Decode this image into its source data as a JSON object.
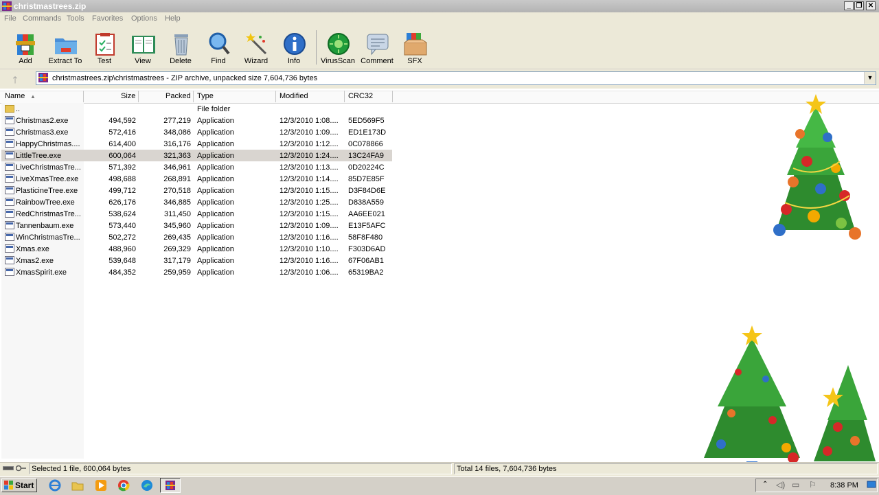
{
  "window": {
    "title": "christmastrees.zip",
    "min": "_",
    "max": "❐",
    "close": "✕"
  },
  "menu": [
    "File",
    "Commands",
    "Tools",
    "Favorites",
    "Options",
    "Help"
  ],
  "toolbar": [
    {
      "label": "Add",
      "icon": "add-archive-icon"
    },
    {
      "label": "Extract To",
      "icon": "extract-folder-icon"
    },
    {
      "label": "Test",
      "icon": "test-checklist-icon"
    },
    {
      "label": "View",
      "icon": "view-book-icon"
    },
    {
      "label": "Delete",
      "icon": "trash-can-icon"
    },
    {
      "label": "Find",
      "icon": "magnifier-icon"
    },
    {
      "label": "Wizard",
      "icon": "magic-wand-icon"
    },
    {
      "label": "Info",
      "icon": "info-icon"
    },
    {
      "label": "VirusScan",
      "icon": "virus-scan-icon"
    },
    {
      "label": "Comment",
      "icon": "comment-icon"
    },
    {
      "label": "SFX",
      "icon": "sfx-box-icon"
    }
  ],
  "address": {
    "up": "🡑",
    "path": "christmastrees.zip\\christmastrees - ZIP archive, unpacked size 7,604,736 bytes",
    "dropdown": "▼"
  },
  "columns": {
    "name": "Name",
    "sort": "▲",
    "size": "Size",
    "packed": "Packed",
    "type": "Type",
    "modified": "Modified",
    "crc": "CRC32"
  },
  "rows": [
    {
      "name": "..",
      "size": "",
      "packed": "",
      "type": "File folder",
      "modified": "",
      "crc": "",
      "folder": true
    },
    {
      "name": "Christmas2.exe",
      "size": "494,592",
      "packed": "277,219",
      "type": "Application",
      "modified": "12/3/2010 1:08....",
      "crc": "5ED569F5"
    },
    {
      "name": "Christmas3.exe",
      "size": "572,416",
      "packed": "348,086",
      "type": "Application",
      "modified": "12/3/2010 1:09....",
      "crc": "ED1E173D"
    },
    {
      "name": "HappyChristmas....",
      "size": "614,400",
      "packed": "316,176",
      "type": "Application",
      "modified": "12/3/2010 1:12....",
      "crc": "0C078866"
    },
    {
      "name": "LittleTree.exe",
      "size": "600,064",
      "packed": "321,363",
      "type": "Application",
      "modified": "12/3/2010 1:24....",
      "crc": "13C24FA9",
      "selected": true
    },
    {
      "name": "LiveChristmasTre...",
      "size": "571,392",
      "packed": "346,961",
      "type": "Application",
      "modified": "12/3/2010 1:13....",
      "crc": "0D20224C"
    },
    {
      "name": "LiveXmasTree.exe",
      "size": "498,688",
      "packed": "268,891",
      "type": "Application",
      "modified": "12/3/2010 1:14....",
      "crc": "85D7E85F"
    },
    {
      "name": "PlasticineTree.exe",
      "size": "499,712",
      "packed": "270,518",
      "type": "Application",
      "modified": "12/3/2010 1:15....",
      "crc": "D3F84D6E"
    },
    {
      "name": "RainbowTree.exe",
      "size": "626,176",
      "packed": "346,885",
      "type": "Application",
      "modified": "12/3/2010 1:25....",
      "crc": "D838A559"
    },
    {
      "name": "RedChristmasTre...",
      "size": "538,624",
      "packed": "311,450",
      "type": "Application",
      "modified": "12/3/2010 1:15....",
      "crc": "AA6EE021"
    },
    {
      "name": "Tannenbaum.exe",
      "size": "573,440",
      "packed": "345,960",
      "type": "Application",
      "modified": "12/3/2010 1:09....",
      "crc": "E13F5AFC"
    },
    {
      "name": "WinChristmasTre...",
      "size": "502,272",
      "packed": "269,435",
      "type": "Application",
      "modified": "12/3/2010 1:16....",
      "crc": "58F8F480"
    },
    {
      "name": "Xmas.exe",
      "size": "488,960",
      "packed": "269,329",
      "type": "Application",
      "modified": "12/3/2010 1:10....",
      "crc": "F303D6AD"
    },
    {
      "name": "Xmas2.exe",
      "size": "539,648",
      "packed": "317,179",
      "type": "Application",
      "modified": "12/3/2010 1:16....",
      "crc": "67F06AB1"
    },
    {
      "name": "XmasSpirit.exe",
      "size": "484,352",
      "packed": "259,959",
      "type": "Application",
      "modified": "12/3/2010 1:06....",
      "crc": "65319BA2"
    }
  ],
  "status": {
    "selected": "Selected 1 file, 600,064 bytes",
    "total": "Total 14 files, 7,604,736 bytes"
  },
  "taskbar": {
    "start": "Start",
    "clock": "8:38 PM"
  },
  "colors": {
    "selection": "#d9d5d0",
    "chrome": "#ece9d8",
    "taskbar": "#d4d0c8"
  }
}
